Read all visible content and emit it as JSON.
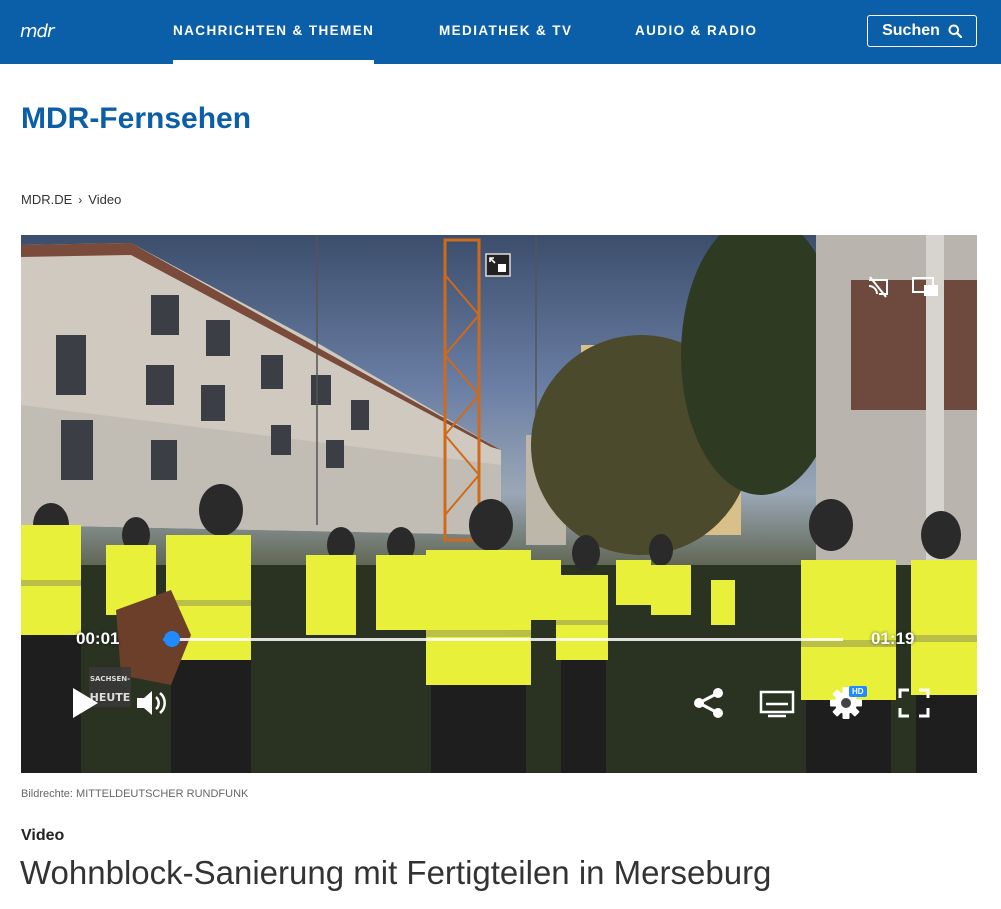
{
  "header": {
    "logo": "mdr",
    "nav": [
      {
        "label": "NACHRICHTEN & THEMEN",
        "active": true
      },
      {
        "label": "MEDIATHEK & TV",
        "active": false
      },
      {
        "label": "AUDIO & RADIO",
        "active": false
      }
    ],
    "search_label": "Suchen",
    "background_color": "#0b5fa8"
  },
  "page_title": "MDR-Fernsehen",
  "breadcrumb": {
    "items": [
      "MDR.DE",
      "Video"
    ],
    "separator": "›"
  },
  "player": {
    "current_time": "00:01",
    "duration": "01:19",
    "progress_fraction": 0.013,
    "hd_badge": "HD",
    "accent_color": "#1f8bff",
    "watermark": "SACHSEN-ANHALT HEUTE",
    "icons": [
      "pip-icon",
      "cast-off-icon",
      "minimize-player-icon",
      "play-icon",
      "volume-icon",
      "share-icon",
      "subtitles-icon",
      "settings-icon",
      "fullscreen-icon"
    ]
  },
  "credit": "Bildrechte: MITTELDEUTSCHER RUNDFUNK",
  "content_type": "Video",
  "headline": "Wohnblock-Sanierung mit Fertigteilen in Merseburg"
}
